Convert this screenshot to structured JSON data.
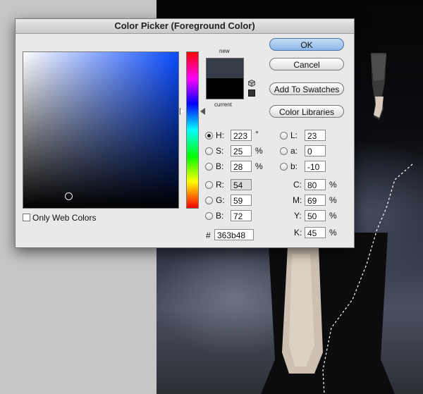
{
  "dialog": {
    "title": "Color Picker (Foreground Color)",
    "new_label": "new",
    "current_label": "current",
    "new_color": "#363b48",
    "current_color": "#000000"
  },
  "buttons": {
    "ok": "OK",
    "cancel": "Cancel",
    "add_to_swatches": "Add To Swatches",
    "color_libraries": "Color Libraries"
  },
  "fields": {
    "H": {
      "label": "H:",
      "value": "223",
      "unit": "°"
    },
    "S": {
      "label": "S:",
      "value": "25",
      "unit": "%"
    },
    "Bv": {
      "label": "B:",
      "value": "28",
      "unit": "%"
    },
    "R": {
      "label": "R:",
      "value": "54"
    },
    "G": {
      "label": "G:",
      "value": "59"
    },
    "Bb": {
      "label": "B:",
      "value": "72"
    },
    "L": {
      "label": "L:",
      "value": "23"
    },
    "a": {
      "label": "a:",
      "value": "0"
    },
    "b": {
      "label": "b:",
      "value": "-10"
    },
    "C": {
      "label": "C:",
      "value": "80",
      "unit": "%"
    },
    "M": {
      "label": "M:",
      "value": "69",
      "unit": "%"
    },
    "Y": {
      "label": "Y:",
      "value": "50",
      "unit": "%"
    },
    "K": {
      "label": "K:",
      "value": "45",
      "unit": "%"
    },
    "hex": {
      "label": "#",
      "value": "363b48"
    }
  },
  "only_web_colors": {
    "label": "Only Web Colors",
    "checked": false
  }
}
